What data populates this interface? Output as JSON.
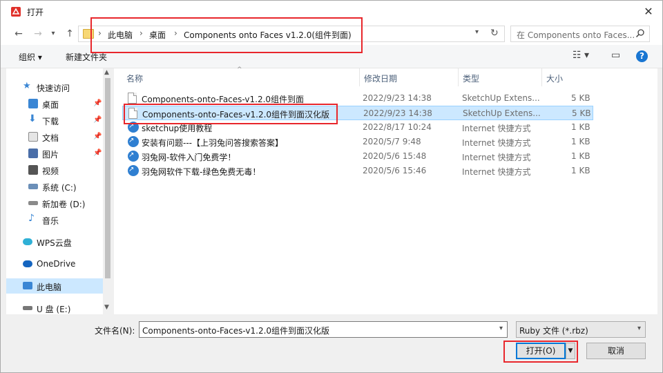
{
  "window": {
    "title": "打开",
    "close_glyph": "✕"
  },
  "nav": {
    "back": "←",
    "forward": "→",
    "up": "↑",
    "dropdown": "▾"
  },
  "address": {
    "crumbs": [
      "此电脑",
      "桌面",
      "Components onto Faces v1.2.0(组件到面)"
    ],
    "separator": "›",
    "refresh": "↻"
  },
  "search": {
    "placeholder": "在 Components onto Faces...",
    "icon": "search-icon"
  },
  "toolbar": {
    "organize": "组织 ▾",
    "new_folder": "新建文件夹",
    "view": "☷ ▾",
    "pane": "▭",
    "help": "?"
  },
  "sidebar": {
    "items": [
      {
        "label": "快速访问",
        "icon": "star-icon",
        "color": "#3a86d4"
      },
      {
        "label": "桌面",
        "icon": "desktop-icon",
        "color": "#3a86d4",
        "pinned": true
      },
      {
        "label": "下载",
        "icon": "download-icon",
        "color": "#3a86d4",
        "pinned": true
      },
      {
        "label": "文档",
        "icon": "document-icon",
        "color": "#8a8a8a",
        "pinned": true
      },
      {
        "label": "图片",
        "icon": "pictures-icon",
        "color": "#4a6ea8",
        "pinned": true
      },
      {
        "label": "视频",
        "icon": "video-icon",
        "color": "#555555"
      },
      {
        "label": "音乐",
        "icon": "music-icon",
        "color": "#3a86d4"
      },
      {
        "label": "系统 (C:)",
        "icon": "drive-icon",
        "color": "#6b8fb8"
      },
      {
        "label": "新加卷 (D:)",
        "icon": "drive-icon",
        "color": "#8a8a8a"
      },
      {
        "label": "音乐",
        "icon": "music-icon",
        "color": "#3a86d4"
      },
      {
        "label": "WPS云盘",
        "icon": "cloud-icon",
        "color": "#2fb0d6"
      },
      {
        "label": "OneDrive",
        "icon": "onedrive-icon",
        "color": "#1565c0"
      },
      {
        "label": "此电脑",
        "icon": "computer-icon",
        "color": "#3a86d4",
        "selected": true
      },
      {
        "label": "U 盘 (E:)",
        "icon": "usb-drive-icon",
        "color": "#777777"
      }
    ],
    "pin_glyph": "📌",
    "scroll_up": "▲",
    "scroll_down": "▼"
  },
  "columns": {
    "name": "名称",
    "modified": "修改日期",
    "type": "类型",
    "size": "大小",
    "sort_glyph": "^"
  },
  "files": [
    {
      "name": "Components-onto-Faces-v1.2.0组件到面",
      "modified": "2022/9/23 14:38",
      "type": "SketchUp Extens...",
      "size": "5 KB",
      "kind": "file"
    },
    {
      "name": "Components-onto-Faces-v1.2.0组件到面汉化版",
      "modified": "2022/9/23 14:38",
      "type": "SketchUp Extens...",
      "size": "5 KB",
      "kind": "file",
      "selected": true
    },
    {
      "name": "sketchup使用教程",
      "modified": "2022/8/17 10:24",
      "type": "Internet 快捷方式",
      "size": "1 KB",
      "kind": "link"
    },
    {
      "name": "安装有问题---【上羽兔问答搜索答案】",
      "modified": "2020/5/7 9:48",
      "type": "Internet 快捷方式",
      "size": "1 KB",
      "kind": "link"
    },
    {
      "name": "羽兔网-软件入门免费学！",
      "modified": "2020/5/6 15:48",
      "type": "Internet 快捷方式",
      "size": "1 KB",
      "kind": "link"
    },
    {
      "name": "羽兔网软件下载-绿色免费无毒！",
      "modified": "2020/5/6 15:46",
      "type": "Internet 快捷方式",
      "size": "1 KB",
      "kind": "link"
    }
  ],
  "footer": {
    "filename_label": "文件名(N):",
    "filename_value": "Components-onto-Faces-v1.2.0组件到面汉化版",
    "filetype_value": "Ruby 文件 (*.rbz)",
    "open_label": "打开(O)",
    "open_dd": "▼",
    "cancel_label": "取消"
  },
  "colors": {
    "accent": "#0078d7",
    "selection": "#cce8ff",
    "annotation": "#e8262b"
  }
}
